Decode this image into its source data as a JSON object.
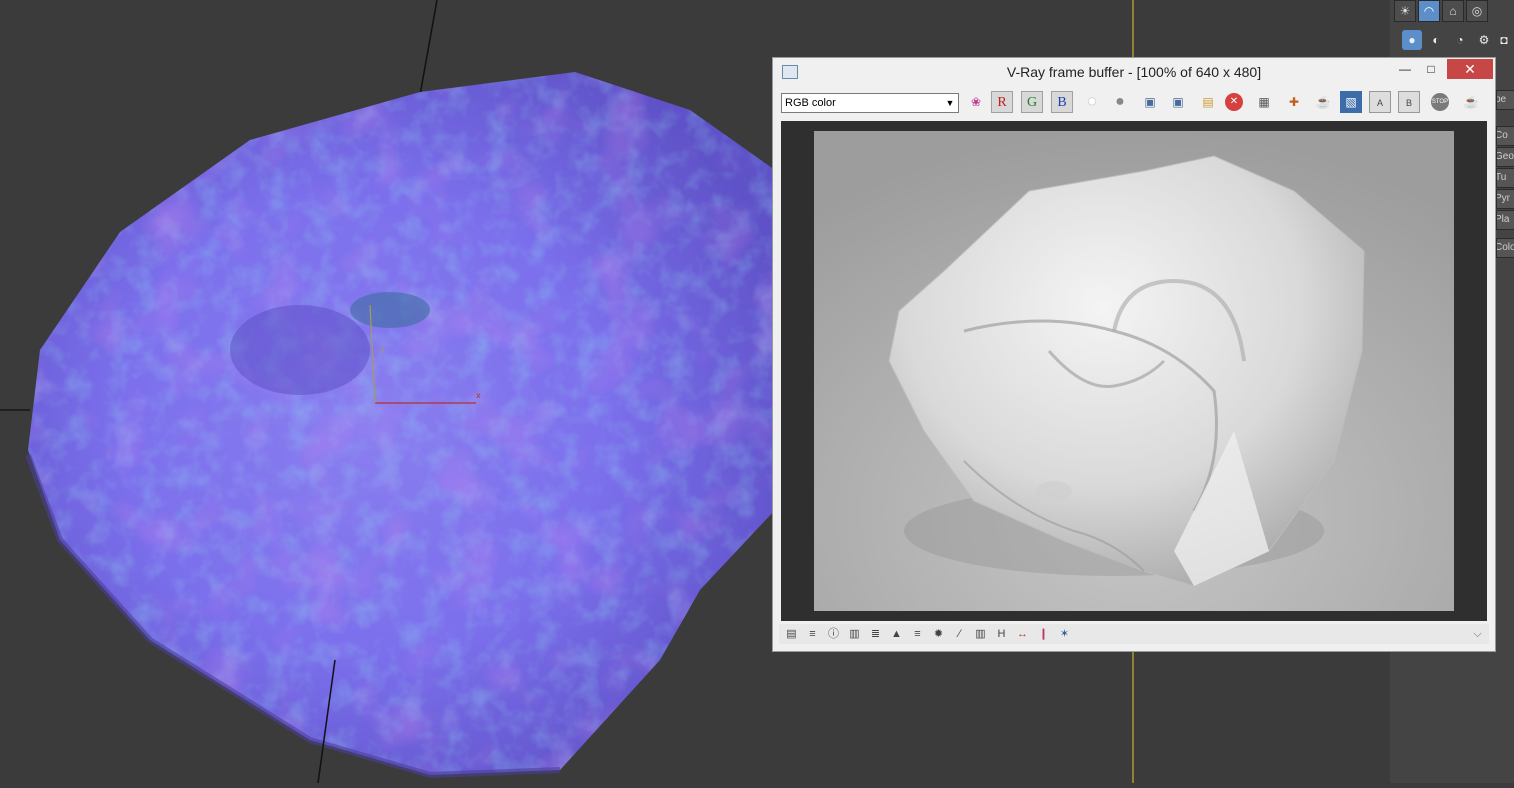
{
  "viewport": {
    "name": "3D viewport",
    "axis_x": "x",
    "axis_y": "y"
  },
  "command_panel": {
    "tabs": [
      "☀",
      "◠",
      "⌂",
      "◎"
    ],
    "icons": [
      "●",
      "◐",
      "◔",
      "⚙",
      "◘"
    ],
    "labels": [
      "pe",
      "Co",
      "GeoS",
      "Tu",
      "Pyr",
      "Pla",
      "Color"
    ]
  },
  "vfb": {
    "title": "V-Ray frame buffer - [100% of 640 x 480]",
    "min_label": "—",
    "max_label": "□",
    "close_label": "✕",
    "channel": "RGB color",
    "channel_arrow": "▼",
    "buttons": {
      "channels": "❀",
      "red": "R",
      "green": "G",
      "blue": "B",
      "mono": "●",
      "alpha": "●",
      "save": "▣",
      "save_all": "▣",
      "open": "▤",
      "clear": "✕",
      "region": "▦",
      "follow": "✚",
      "render_last": "☕",
      "link": "▧",
      "compare_a": "A",
      "compare_b": "B",
      "stop": "STOP",
      "render": "☕"
    },
    "status_icons": [
      "▤",
      "≡",
      "ⓘ",
      "▥",
      "≣",
      "▲",
      "≡",
      "✹",
      "∕",
      "▥",
      "H",
      "↔",
      "❙",
      "✶"
    ],
    "expand": "⌵"
  },
  "colors": {
    "accent": "#5c8fc9",
    "close": "#c74646"
  }
}
